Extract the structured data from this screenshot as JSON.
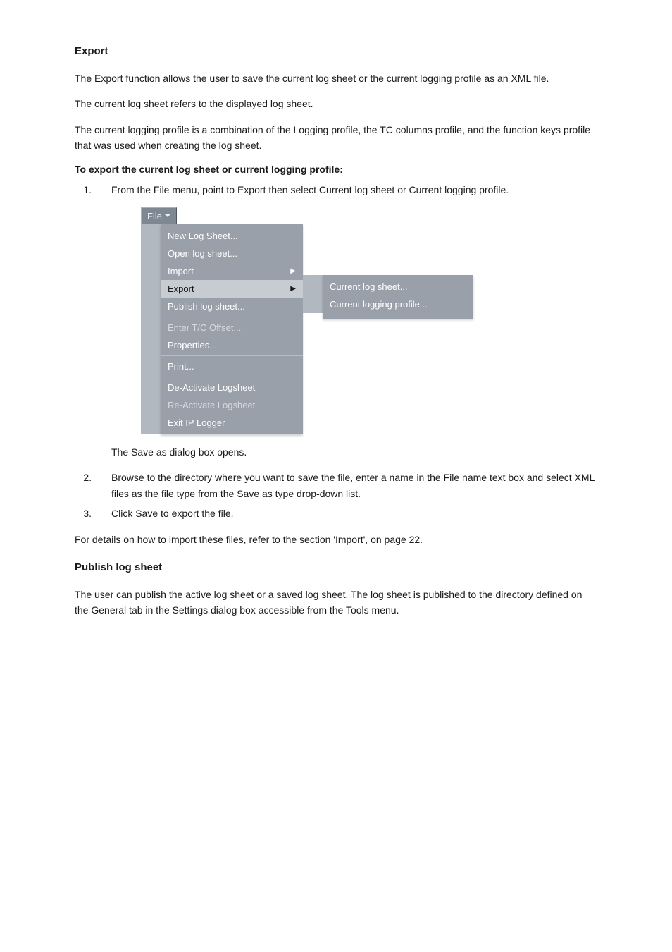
{
  "section_export": {
    "heading": "Export",
    "p1": "The Export function allows the user to save the current log sheet or the current logging profile as an XML file.",
    "p2": "The current log sheet refers to the displayed log sheet.",
    "p3": "The current logging profile is a combination of the Logging profile, the TC columns profile, and the function keys profile that was used when creating the log sheet.",
    "proc_head": "To export the current log sheet or current logging profile:",
    "step1": "From the File menu, point to Export then select Current log sheet or Current logging profile.",
    "step2": "The Save as dialog box opens.",
    "step3": "Browse to the directory where you want to save the file, enter a name in the File name text box and select XML files as the file type from the Save as type drop-down list.",
    "step4": "Click Save to export the file.",
    "step5": "For details on how to import these files, refer to the section 'Import', on page 22."
  },
  "section_publish": {
    "heading": "Publish log sheet",
    "p1": "The user can publish the active log sheet or a saved log sheet. The log sheet is published to the directory defined on the General tab in the Settings dialog box accessible from the Tools menu."
  },
  "menu": {
    "file_tab": "File",
    "items": [
      {
        "label": "New Log Sheet...",
        "disabled": false,
        "submenu": false,
        "highlight": false
      },
      {
        "label": "Open log sheet...",
        "disabled": false,
        "submenu": false,
        "highlight": false
      },
      {
        "label": "Import",
        "disabled": false,
        "submenu": true,
        "highlight": false
      },
      {
        "label": "Export",
        "disabled": false,
        "submenu": true,
        "highlight": true
      },
      {
        "label": "Publish log sheet...",
        "disabled": false,
        "submenu": false,
        "highlight": false
      },
      {
        "label": "---"
      },
      {
        "label": "Enter T/C Offset...",
        "disabled": true,
        "submenu": false,
        "highlight": false
      },
      {
        "label": "Properties...",
        "disabled": false,
        "submenu": false,
        "highlight": false
      },
      {
        "label": "---"
      },
      {
        "label": "Print...",
        "disabled": false,
        "submenu": false,
        "highlight": false
      },
      {
        "label": "---"
      },
      {
        "label": "De-Activate Logsheet",
        "disabled": false,
        "submenu": false,
        "highlight": false
      },
      {
        "label": "Re-Activate Logsheet",
        "disabled": true,
        "submenu": false,
        "highlight": false
      },
      {
        "label": "Exit IP Logger",
        "disabled": false,
        "submenu": false,
        "highlight": false
      }
    ],
    "submenu": [
      {
        "label": "Current log sheet..."
      },
      {
        "label": "Current logging profile..."
      }
    ]
  }
}
